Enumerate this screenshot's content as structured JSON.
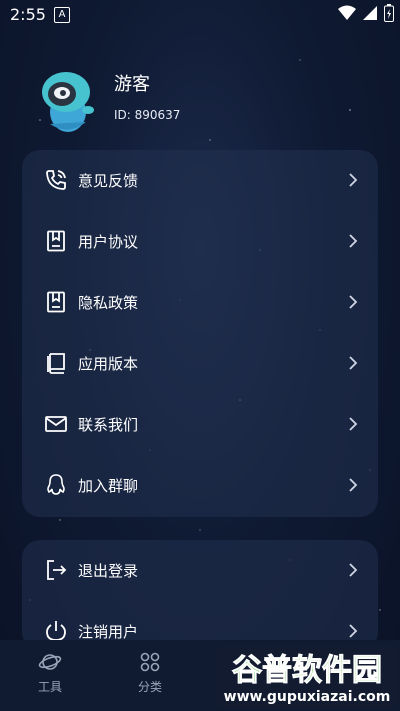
{
  "status_bar": {
    "time": "2:55",
    "indicator": "A"
  },
  "profile": {
    "name": "游客",
    "id": "ID: 890637"
  },
  "menu": [
    {
      "label": "意见反馈",
      "icon": "phone-icon"
    },
    {
      "label": "用户协议",
      "icon": "document-icon"
    },
    {
      "label": "隐私政策",
      "icon": "document-icon"
    },
    {
      "label": "应用版本",
      "icon": "book-icon"
    },
    {
      "label": "联系我们",
      "icon": "mail-icon"
    },
    {
      "label": "加入群聊",
      "icon": "qq-icon"
    }
  ],
  "menu2": [
    {
      "label": "退出登录",
      "icon": "logout-icon"
    },
    {
      "label": "注销用户",
      "icon": "power-icon"
    }
  ],
  "tabs": [
    {
      "label": "工具",
      "icon": "planet-icon"
    },
    {
      "label": "分类",
      "icon": "grid-icon"
    }
  ],
  "watermark": {
    "title": "谷普软件园",
    "url": "www.gupuxiazai.com"
  }
}
